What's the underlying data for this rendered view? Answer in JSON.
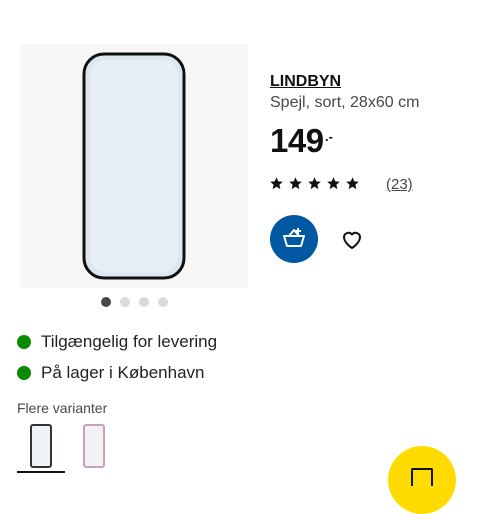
{
  "product": {
    "name": "LINDBYN",
    "description": "Spejl, sort, 28x60 cm",
    "price": "149",
    "price_suffix": ".-",
    "rating": 5,
    "review_count": "(23)"
  },
  "gallery": {
    "image_count": 4,
    "active_index": 0
  },
  "availability": [
    {
      "text": "Tilgængelig for levering",
      "status": "available",
      "color": "#0a8a00"
    },
    {
      "text": "På lager i København",
      "status": "available",
      "color": "#0a8a00"
    }
  ],
  "variants": {
    "label": "Flere varianter",
    "items": [
      {
        "name": "black",
        "selected": true
      },
      {
        "name": "pink",
        "selected": false
      }
    ]
  },
  "colors": {
    "cart_button": "#0058a3",
    "fab": "#ffdb00",
    "available": "#0a8a00"
  },
  "icons": {
    "cart": "add-to-cart-icon",
    "favorite": "heart-icon",
    "star": "star-icon",
    "fab": "shopping-bag-icon"
  }
}
